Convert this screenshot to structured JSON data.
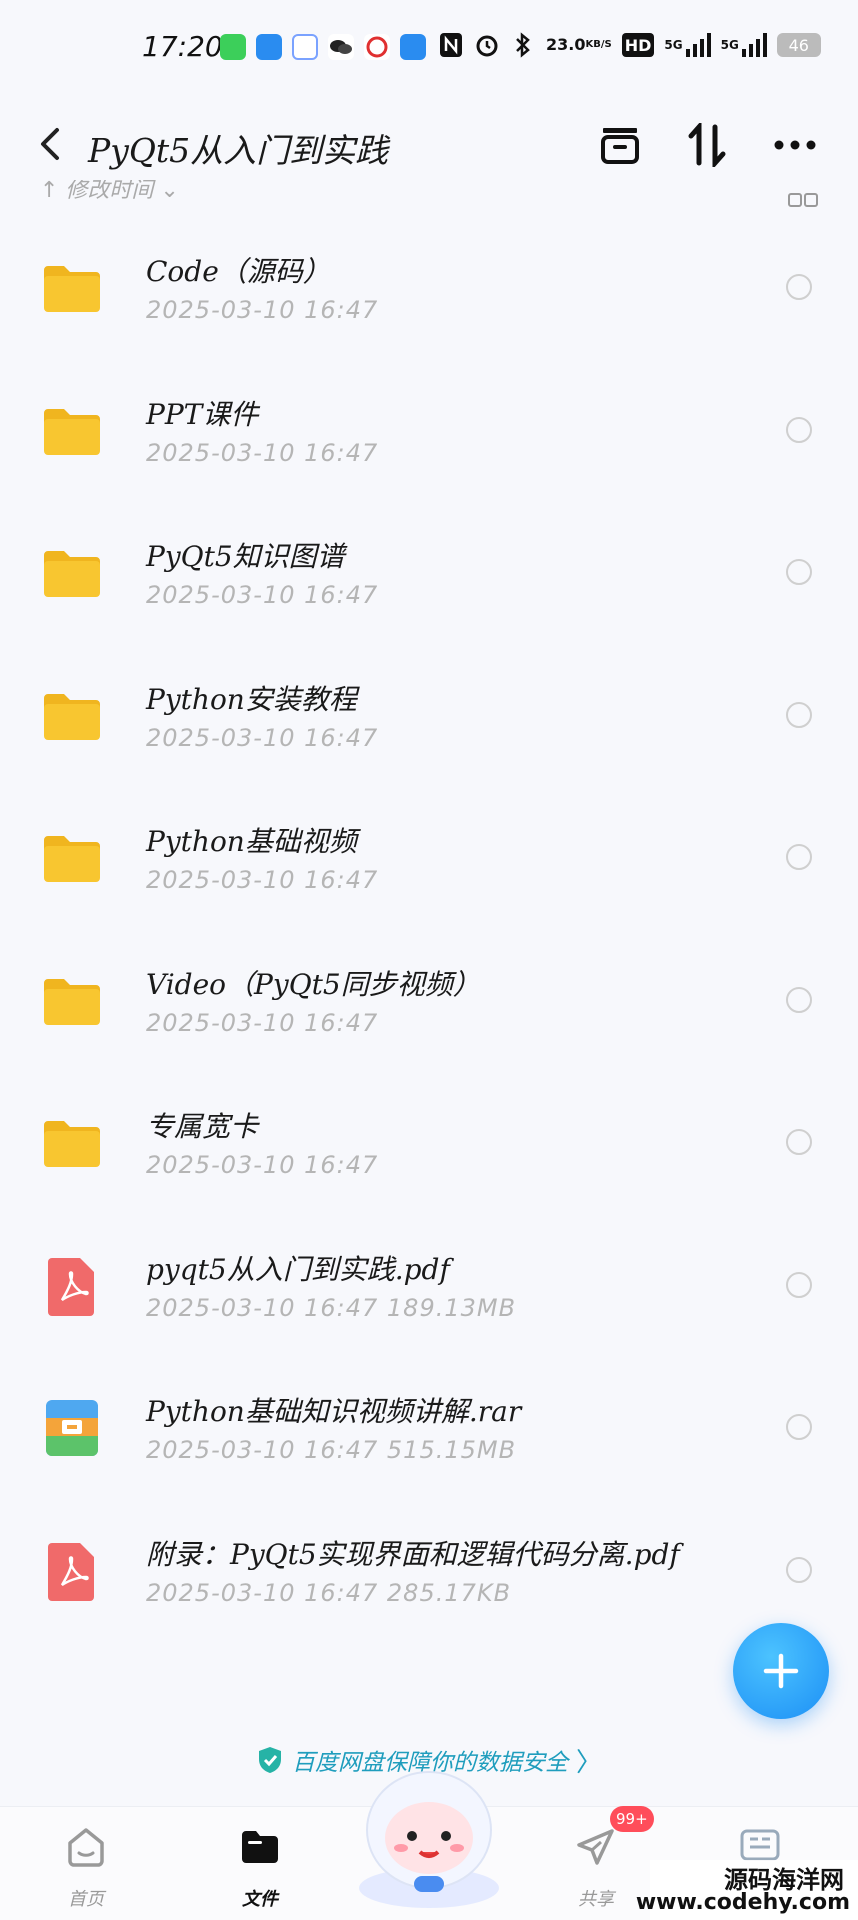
{
  "status_bar": {
    "time": "17:20",
    "net_speed_value": "23.0",
    "net_speed_unit": "KB/S",
    "hd_label": "HD",
    "signal_1": "5G",
    "signal_2": "5G",
    "battery": "46",
    "left_app_icons": [
      "messages-icon",
      "phone-icon",
      "app-icon",
      "wechat-icon",
      "unicom-icon",
      "infinity-icon"
    ],
    "right_icons": [
      "nfc-icon",
      "alarm-icon",
      "bluetooth-icon"
    ]
  },
  "header": {
    "title": "PyQt5从入门到实践",
    "icons": [
      "back-icon",
      "archive-icon",
      "sort-icon",
      "more-icon"
    ]
  },
  "subbar": {
    "sort_label": "↑ 修改时间 ⌄"
  },
  "files": [
    {
      "name": "Code（源码）",
      "meta": "2025-03-10  16:47",
      "type": "folder"
    },
    {
      "name": "PPT课件",
      "meta": "2025-03-10  16:47",
      "type": "folder"
    },
    {
      "name": "PyQt5知识图谱",
      "meta": "2025-03-10  16:47",
      "type": "folder"
    },
    {
      "name": "Python安装教程",
      "meta": "2025-03-10  16:47",
      "type": "folder"
    },
    {
      "name": "Python基础视频",
      "meta": "2025-03-10  16:47",
      "type": "folder"
    },
    {
      "name": "Video（PyQt5同步视频）",
      "meta": "2025-03-10  16:47",
      "type": "folder"
    },
    {
      "name": "专属宽卡",
      "meta": "2025-03-10  16:47",
      "type": "folder"
    },
    {
      "name": "pyqt5从入门到实践.pdf",
      "meta": "2025-03-10  16:47  189.13MB",
      "type": "pdf"
    },
    {
      "name": "Python基础知识视频讲解.rar",
      "meta": "2025-03-10  16:47  515.15MB",
      "type": "rar"
    },
    {
      "name": "附录：PyQt5实现界面和逻辑代码分离.pdf",
      "meta": "2025-03-10  16:47  285.17KB",
      "type": "pdf"
    }
  ],
  "security_banner": {
    "text": "百度网盘保障你的数据安全",
    "chevron": "〉"
  },
  "bottom_nav": {
    "items": [
      {
        "label": "首页",
        "icon": "home-icon"
      },
      {
        "label": "文件",
        "icon": "folder-icon"
      },
      {
        "label": "共享",
        "icon": "share-icon"
      },
      {
        "label": "",
        "icon": "mini-app-icon"
      }
    ],
    "share_badge": "99+"
  },
  "watermark": {
    "line1": "源码海洋网",
    "line2": "www.codehy.com"
  },
  "colors": {
    "accent": "#1c8ff5",
    "folder": "#f8c630",
    "pdf": "#f06a6a",
    "badge": "#ff4d5a",
    "security_text": "#1f9dbd"
  }
}
